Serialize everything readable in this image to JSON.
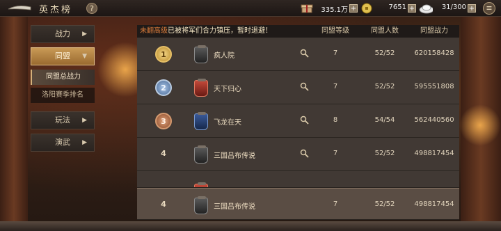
{
  "header": {
    "title": "英杰榜",
    "help_label": "?",
    "resources": [
      {
        "icon": "gift-box-icon",
        "value": "335.1万"
      },
      {
        "icon": "copper-coin-icon",
        "value": "7651"
      },
      {
        "icon": "silver-ingot-icon",
        "value": "31/300"
      }
    ],
    "plus_label": "+",
    "menu_label": "≡"
  },
  "sidebar": {
    "items": [
      {
        "label": "战力",
        "arrow": "▶",
        "active": false
      },
      {
        "label": "同盟",
        "arrow": "▼",
        "active": true
      },
      {
        "label": "玩法",
        "arrow": "▶",
        "active": false
      },
      {
        "label": "演武",
        "arrow": "▶",
        "active": false
      }
    ],
    "sub_items": [
      {
        "label": "同盟总战力",
        "active": true
      },
      {
        "label": "洛阳赛季排名",
        "active": false
      }
    ]
  },
  "board": {
    "notice_prefix": "未翻高级",
    "notice_text": "已被将军们合力镇压，暂时退避！",
    "columns": [
      "同盟等级",
      "同盟人数",
      "同盟战力"
    ],
    "rows": [
      {
        "rank": "1",
        "rank_style": "gold",
        "flag": "black",
        "name": "疯人院",
        "level": "7",
        "members": "52/52",
        "power": "620158428"
      },
      {
        "rank": "2",
        "rank_style": "silver",
        "flag": "red",
        "name": "天下归心",
        "level": "7",
        "members": "52/52",
        "power": "595551808"
      },
      {
        "rank": "3",
        "rank_style": "bronze",
        "flag": "blue",
        "name": "飞龙在天",
        "level": "8",
        "members": "54/54",
        "power": "562440560"
      },
      {
        "rank": "4",
        "rank_style": "plain",
        "flag": "black",
        "name": "三国吕布传说",
        "level": "7",
        "members": "52/52",
        "power": "498817454"
      }
    ],
    "my_row": {
      "rank": "4",
      "rank_style": "plain",
      "flag": "black",
      "name": "三国吕布传说",
      "level": "7",
      "members": "52/52",
      "power": "498817454"
    }
  }
}
